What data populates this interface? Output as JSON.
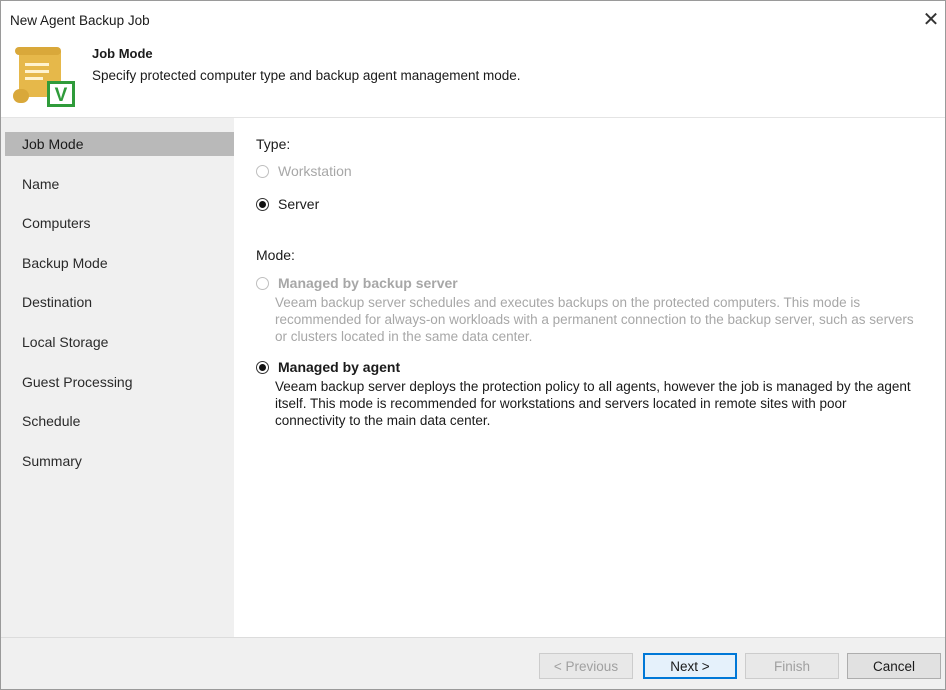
{
  "window": {
    "title": "New Agent Backup Job",
    "close_icon": "close-icon"
  },
  "header": {
    "title": "Job Mode",
    "description": "Specify protected computer type and backup agent management mode.",
    "logo_icon": "scroll-checkmark-icon",
    "logo_letter": "V",
    "colors": {
      "scroll": "#e6b84a",
      "badge": "#2f9b3a"
    }
  },
  "sidebar": {
    "items": [
      {
        "label": "Job Mode",
        "active": true
      },
      {
        "label": "Name"
      },
      {
        "label": "Computers"
      },
      {
        "label": "Backup Mode"
      },
      {
        "label": "Destination"
      },
      {
        "label": "Local Storage"
      },
      {
        "label": "Guest Processing"
      },
      {
        "label": "Schedule"
      },
      {
        "label": "Summary"
      }
    ]
  },
  "main": {
    "type_label": "Type:",
    "type_options": [
      {
        "label": "Workstation",
        "checked": false,
        "disabled": true
      },
      {
        "label": "Server",
        "checked": true,
        "disabled": false
      }
    ],
    "mode_label": "Mode:",
    "mode_options": [
      {
        "label": "Managed by backup server",
        "checked": false,
        "disabled": true,
        "description": "Veeam backup server schedules and executes backups on the protected computers. This mode is recommended for always-on workloads with a permanent connection to the backup server, such as servers or clusters located in the same data center."
      },
      {
        "label": "Managed by agent",
        "checked": true,
        "disabled": false,
        "description": "Veeam backup server deploys the protection policy to all agents, however the job is managed by the agent itself. This mode is recommended for workstations and servers located in remote sites with poor connectivity to the main data center."
      }
    ]
  },
  "footer": {
    "previous_label": "< Previous",
    "next_label": "Next >",
    "finish_label": "Finish",
    "cancel_label": "Cancel"
  }
}
